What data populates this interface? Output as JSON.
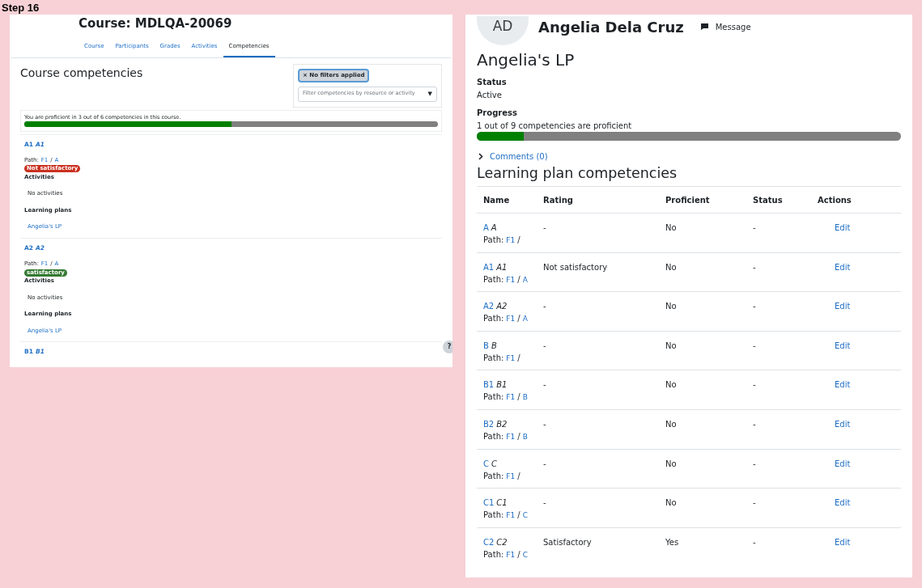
{
  "step_label": "Step 16",
  "course_page": {
    "title": "Course: MDLQA-20069",
    "tabs": [
      {
        "label": "Course",
        "selected": false
      },
      {
        "label": "Participants",
        "selected": false
      },
      {
        "label": "Grades",
        "selected": false
      },
      {
        "label": "Activities",
        "selected": false
      },
      {
        "label": "Competencies",
        "selected": true
      }
    ],
    "heading": "Course competencies",
    "filter_chip": "× No filters applied",
    "filter_select": {
      "placeholder": "Filter competencies by resource or activity",
      "caret": "▼"
    },
    "progress": {
      "text": "You are proficient in 3 out of 6 competencies in this course.",
      "level": 0.5
    },
    "competencies": [
      {
        "code": "A1",
        "name": "A1",
        "path_label": "Path:",
        "path": [
          "F1",
          "/",
          "A"
        ],
        "rating": "Not satisfactory",
        "color": "#ca3120",
        "activities_label": "Activities",
        "activities": "No activities",
        "plans_label": "Learning plans",
        "plan": "Angelia's LP"
      },
      {
        "code": "A2",
        "name": "A2",
        "path_label": "Path:",
        "path": [
          "F1",
          "/",
          "A"
        ],
        "rating": "satisfactory",
        "color": "#357a32",
        "activities_label": "Activities",
        "activities": "No activities",
        "plans_label": "Learning plans",
        "plan": "Angelia's LP"
      },
      {
        "code": "B1",
        "name": "B1"
      }
    ],
    "help_button": "?"
  },
  "plan_page": {
    "avatar": "AD",
    "user_name": "Angelia Dela Cruz",
    "message_button": "Message",
    "title": "Angelia's LP",
    "status_label": "Status",
    "status": "Active",
    "progress_label": "Progress",
    "progress_text": "1 out of 9 competencies are proficient",
    "level": 0.111,
    "comments_link": "Comments (0)",
    "table_heading": "Learning plan competencies",
    "table": {
      "columns": [
        "Name",
        "Rating",
        "Proficient",
        "Status",
        "Actions"
      ],
      "rows": [
        {
          "code": "A",
          "name": "A",
          "path_label": "Path:",
          "path": [
            "F1",
            "/"
          ],
          "rating": "-",
          "proficient": "No",
          "status": "-",
          "action": "Edit"
        },
        {
          "code": "A1",
          "name": "A1",
          "path_label": "Path:",
          "path": [
            "F1",
            "/",
            "A"
          ],
          "rating": "Not satisfactory",
          "proficient": "No",
          "status": "-",
          "action": "Edit"
        },
        {
          "code": "A2",
          "name": "A2",
          "path_label": "Path:",
          "path": [
            "F1",
            "/",
            "A"
          ],
          "rating": "-",
          "proficient": "No",
          "status": "-",
          "action": "Edit"
        },
        {
          "code": "B",
          "name": "B",
          "path_label": "Path:",
          "path": [
            "F1",
            "/"
          ],
          "rating": "-",
          "proficient": "No",
          "status": "-",
          "action": "Edit"
        },
        {
          "code": "B1",
          "name": "B1",
          "path_label": "Path:",
          "path": [
            "F1",
            "/",
            "B"
          ],
          "rating": "-",
          "proficient": "No",
          "status": "-",
          "action": "Edit"
        },
        {
          "code": "B2",
          "name": "B2",
          "path_label": "Path:",
          "path": [
            "F1",
            "/",
            "B"
          ],
          "rating": "-",
          "proficient": "No",
          "status": "-",
          "action": "Edit"
        },
        {
          "code": "C",
          "name": "C",
          "path_label": "Path:",
          "path": [
            "F1",
            "/"
          ],
          "rating": "-",
          "proficient": "No",
          "status": "-",
          "action": "Edit"
        },
        {
          "code": "C1",
          "name": "C1",
          "path_label": "Path:",
          "path": [
            "F1",
            "/",
            "C"
          ],
          "rating": "-",
          "proficient": "No",
          "status": "-",
          "action": "Edit"
        },
        {
          "code": "C2",
          "name": "C2",
          "path_label": "Path:",
          "path": [
            "F1",
            "/",
            "C"
          ],
          "rating": "Satisfactory",
          "proficient": "Yes",
          "status": "-",
          "action": "Edit"
        }
      ]
    }
  }
}
